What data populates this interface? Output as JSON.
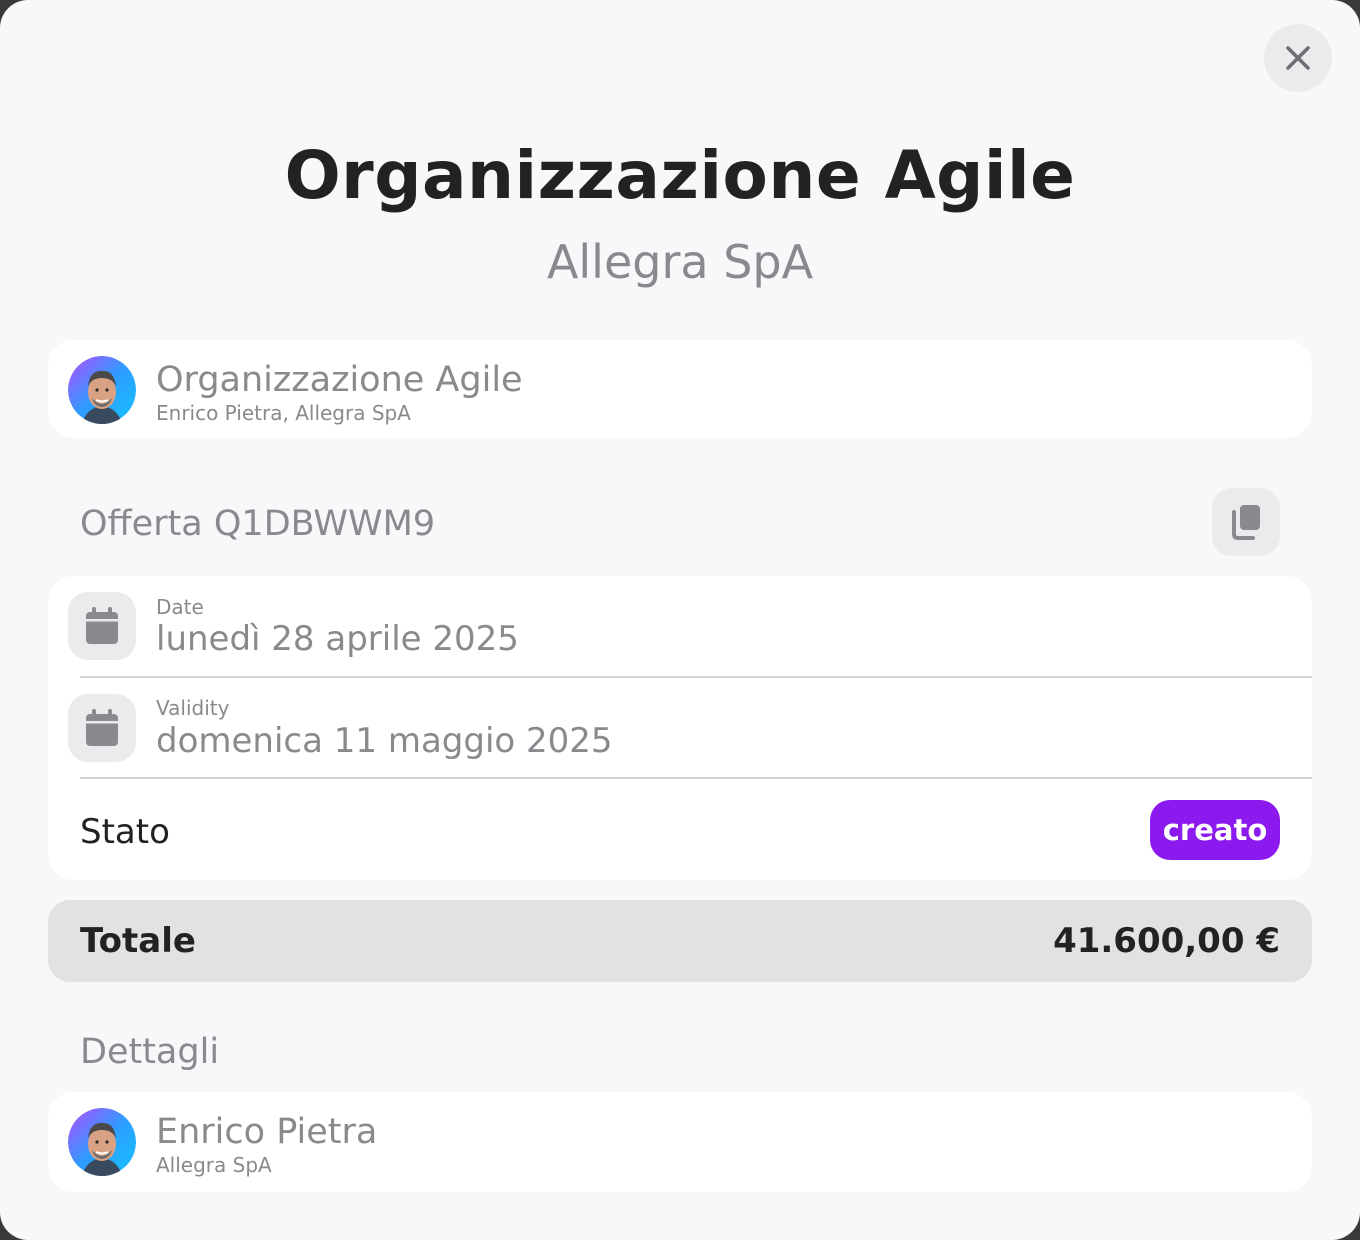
{
  "header": {
    "title": "Organizzazione Agile",
    "subtitle": "Allegra SpA"
  },
  "close_icon": "close-icon",
  "organization_card": {
    "name": "Organizzazione Agile",
    "sub": "Enrico Pietra, Allegra SpA",
    "avatar_icon": "avatar"
  },
  "offer": {
    "label": "Offerta Q1DBWWM9",
    "copy_icon": "copy-icon"
  },
  "details_card": {
    "date_label": "Date",
    "date_value": "lunedì 28 aprile 2025",
    "validity_label": "Validity",
    "validity_value": "domenica 11 maggio 2025",
    "status_label": "Stato",
    "status_value": "creato",
    "calendar_icon": "calendar-icon"
  },
  "total": {
    "label": "Totale",
    "value": "41.600,00 €"
  },
  "details_section": {
    "label": "Dettagli"
  },
  "contact_card": {
    "name": "Enrico Pietra",
    "sub": "Allegra SpA"
  },
  "colors": {
    "accent": "#8c1aef",
    "background": "#f7f8fa",
    "card": "#ffffff",
    "muted_text": "#8a8a8e",
    "dark_text": "#222225"
  }
}
